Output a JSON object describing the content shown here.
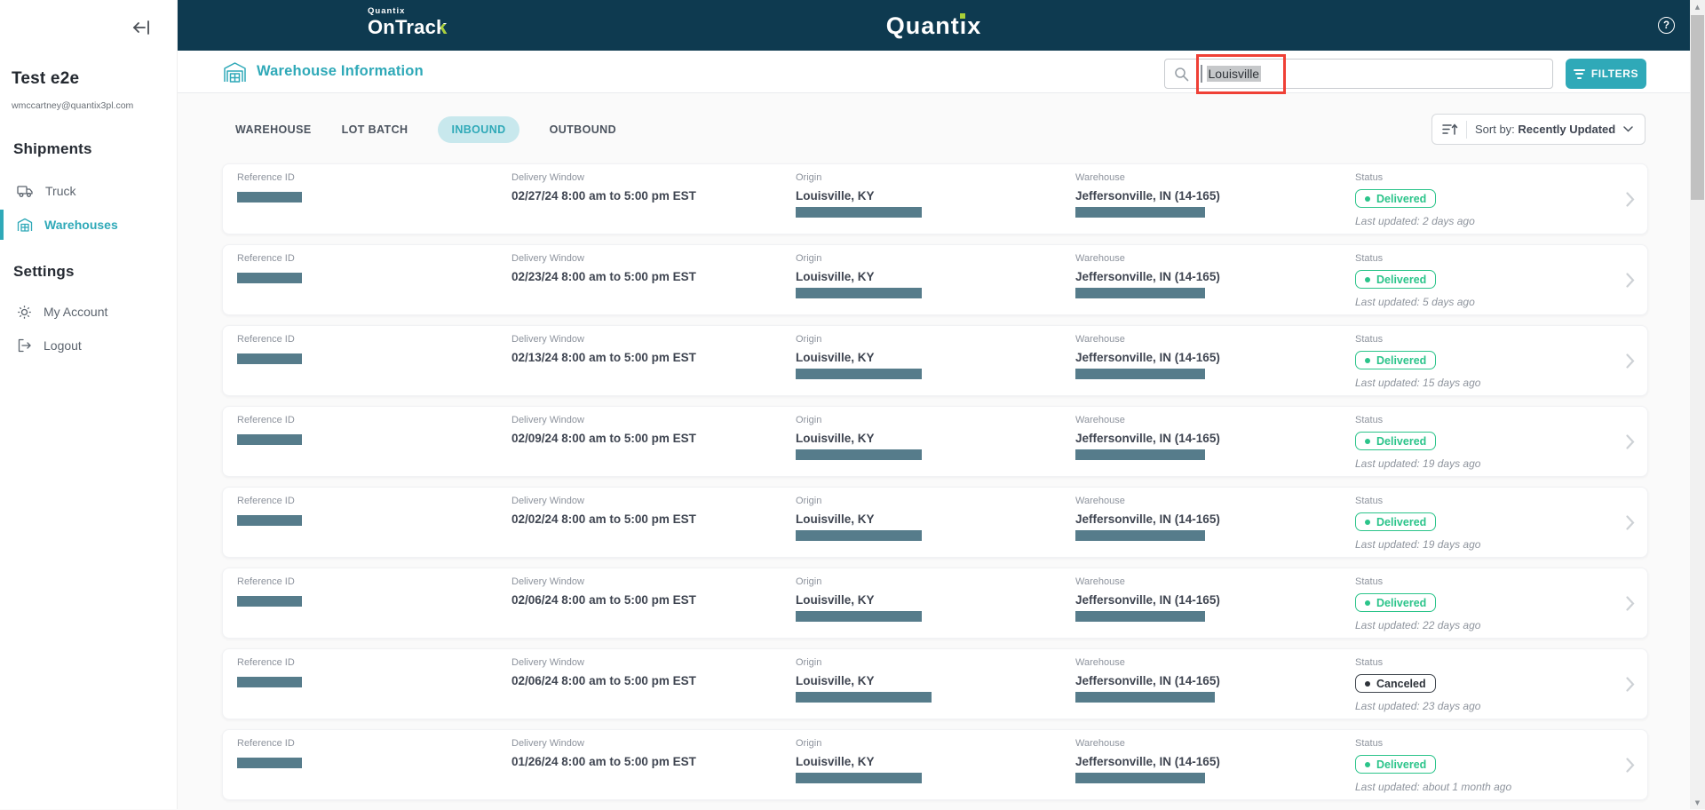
{
  "colors": {
    "navy": "#0e3a50",
    "accent": "#2fa9b8",
    "lime": "#a9cf38",
    "tab_pill_bg": "#c8e8ed",
    "delivered_green": "#2bc48a",
    "canceled_dark": "#41474f",
    "redacted_bar": "#567c8b",
    "annotation_red": "#ef4036",
    "selection_gray": "#c6c8ca"
  },
  "header": {
    "brand_top": "Quantix",
    "brand_bottom": "OnTrack",
    "center_logo": "Quantix",
    "help_glyph": "?"
  },
  "sidebar": {
    "user_name": "Test e2e",
    "user_email": "wmccartney@quantix3pl.com",
    "shipments_heading": "Shipments",
    "truck_label": "Truck",
    "warehouses_label": "Warehouses",
    "settings_heading": "Settings",
    "my_account_label": "My Account",
    "logout_label": "Logout"
  },
  "toolbar": {
    "page_title": "Warehouse Information",
    "search_value": "Louisville",
    "filters_label": "FILTERS"
  },
  "tabs": {
    "items": [
      {
        "label": "WAREHOUSE",
        "active": false
      },
      {
        "label": "LOT BATCH",
        "active": false
      },
      {
        "label": "INBOUND",
        "active": true
      },
      {
        "label": "OUTBOUND",
        "active": false
      }
    ]
  },
  "sort": {
    "prefix": "Sort by:",
    "value": "Recently Updated"
  },
  "list": {
    "labels": {
      "reference": "Reference ID",
      "delivery": "Delivery Window",
      "origin": "Origin",
      "warehouse": "Warehouse",
      "status": "Status"
    },
    "rows": [
      {
        "delivery_window": "02/27/24 8:00 am to 5:00 pm EST",
        "origin": "Louisville, KY",
        "warehouse": "Jeffersonville, IN (14-165)",
        "status": "Delivered",
        "status_type": "delivered",
        "last_updated": "Last updated: 2 days ago",
        "ref_bar": 73,
        "origin_bar": 142,
        "warehouse_bar": 146
      },
      {
        "delivery_window": "02/23/24 8:00 am to 5:00 pm EST",
        "origin": "Louisville, KY",
        "warehouse": "Jeffersonville, IN (14-165)",
        "status": "Delivered",
        "status_type": "delivered",
        "last_updated": "Last updated: 5 days ago",
        "ref_bar": 73,
        "origin_bar": 142,
        "warehouse_bar": 146
      },
      {
        "delivery_window": "02/13/24 8:00 am to 5:00 pm EST",
        "origin": "Louisville, KY",
        "warehouse": "Jeffersonville, IN (14-165)",
        "status": "Delivered",
        "status_type": "delivered",
        "last_updated": "Last updated: 15 days ago",
        "ref_bar": 73,
        "origin_bar": 142,
        "warehouse_bar": 146
      },
      {
        "delivery_window": "02/09/24 8:00 am to 5:00 pm EST",
        "origin": "Louisville, KY",
        "warehouse": "Jeffersonville, IN (14-165)",
        "status": "Delivered",
        "status_type": "delivered",
        "last_updated": "Last updated: 19 days ago",
        "ref_bar": 73,
        "origin_bar": 142,
        "warehouse_bar": 146
      },
      {
        "delivery_window": "02/02/24 8:00 am to 5:00 pm EST",
        "origin": "Louisville, KY",
        "warehouse": "Jeffersonville, IN (14-165)",
        "status": "Delivered",
        "status_type": "delivered",
        "last_updated": "Last updated: 19 days ago",
        "ref_bar": 73,
        "origin_bar": 142,
        "warehouse_bar": 146
      },
      {
        "delivery_window": "02/06/24 8:00 am to 5:00 pm EST",
        "origin": "Louisville, KY",
        "warehouse": "Jeffersonville, IN (14-165)",
        "status": "Delivered",
        "status_type": "delivered",
        "last_updated": "Last updated: 22 days ago",
        "ref_bar": 73,
        "origin_bar": 142,
        "warehouse_bar": 146
      },
      {
        "delivery_window": "02/06/24 8:00 am to 5:00 pm EST",
        "origin": "Louisville, KY",
        "warehouse": "Jeffersonville, IN (14-165)",
        "status": "Canceled",
        "status_type": "canceled",
        "last_updated": "Last updated: 23 days ago",
        "ref_bar": 73,
        "origin_bar": 153,
        "warehouse_bar": 157
      },
      {
        "delivery_window": "01/26/24 8:00 am to 5:00 pm EST",
        "origin": "Louisville, KY",
        "warehouse": "Jeffersonville, IN (14-165)",
        "status": "Delivered",
        "status_type": "delivered",
        "last_updated": "Last updated: about 1 month ago",
        "ref_bar": 73,
        "origin_bar": 142,
        "warehouse_bar": 146
      }
    ]
  }
}
